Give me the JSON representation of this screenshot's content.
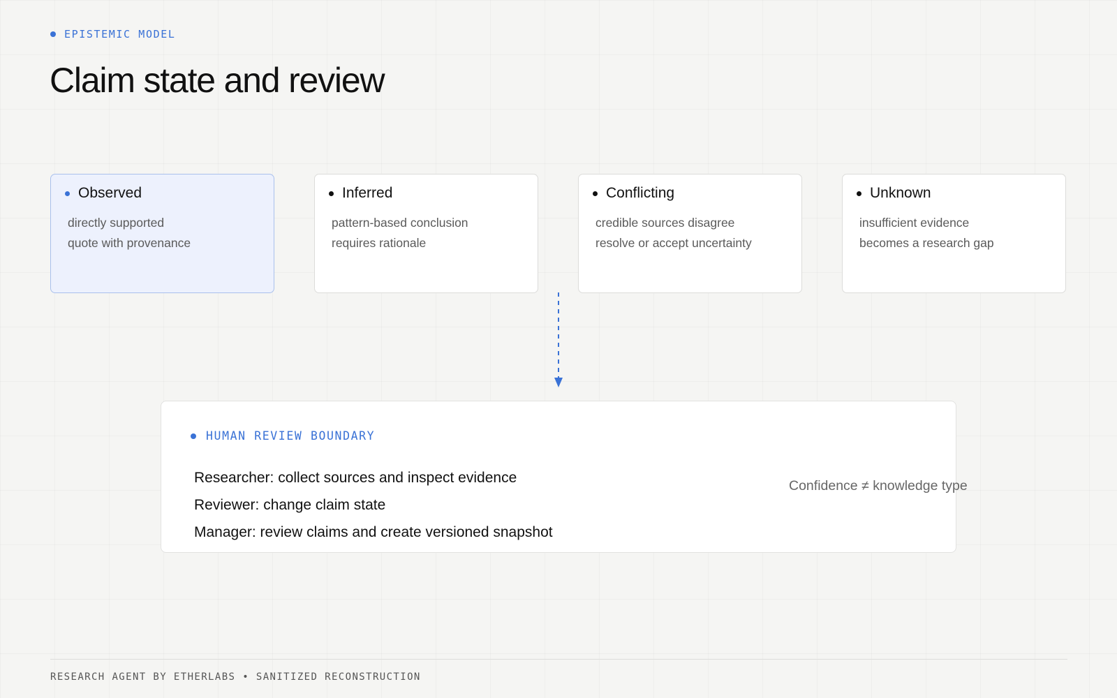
{
  "header": {
    "eyebrow": "EPISTEMIC MODEL",
    "title": "Claim state and review"
  },
  "states": [
    {
      "label": "Observed",
      "lines": [
        "directly supported",
        "quote with provenance"
      ],
      "highlighted": true
    },
    {
      "label": "Inferred",
      "lines": [
        "pattern-based conclusion",
        "requires rationale"
      ],
      "highlighted": false
    },
    {
      "label": "Conflicting",
      "lines": [
        "credible sources disagree",
        "resolve or accept uncertainty"
      ],
      "highlighted": false
    },
    {
      "label": "Unknown",
      "lines": [
        "insufficient evidence",
        "becomes a research gap"
      ],
      "highlighted": false
    }
  ],
  "review": {
    "label": "HUMAN REVIEW BOUNDARY",
    "roles": [
      "Researcher: collect sources and inspect evidence",
      "Reviewer: change claim state",
      "Manager: review claims and create versioned snapshot"
    ],
    "note": "Confidence ≠ knowledge type"
  },
  "footer": {
    "text": "RESEARCH AGENT BY ETHERLABS • SANITIZED RECONSTRUCTION"
  },
  "colors": {
    "accent": "#3a72d6",
    "highlight_fill": "#edf1fd",
    "highlight_border": "#a9c0ec"
  }
}
